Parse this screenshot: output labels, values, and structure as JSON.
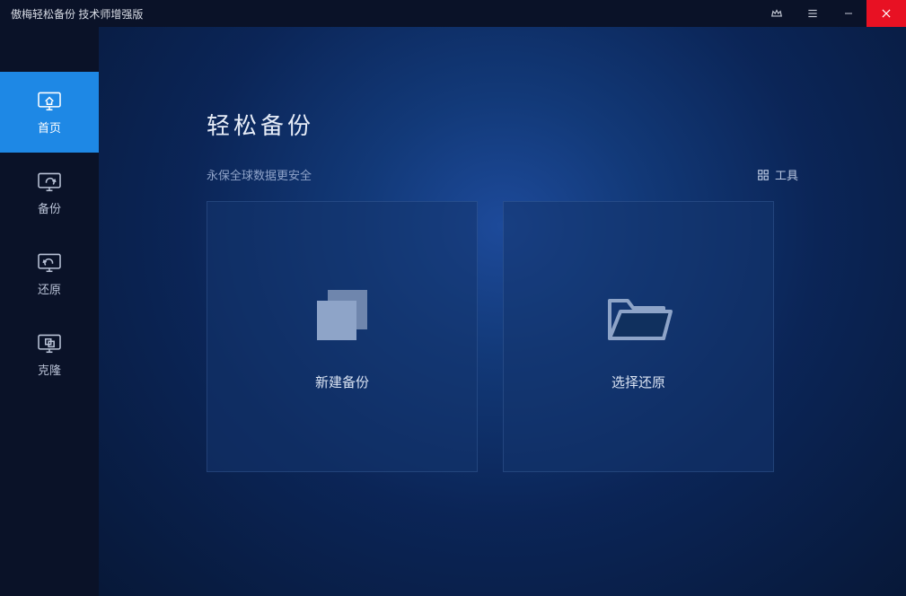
{
  "titlebar": {
    "title": "傲梅轻松备份 技术师增强版"
  },
  "sidebar": {
    "items": [
      {
        "label": "首页"
      },
      {
        "label": "备份"
      },
      {
        "label": "还原"
      },
      {
        "label": "克隆"
      }
    ]
  },
  "main": {
    "title": "轻松备份",
    "subtitle": "永保全球数据更安全",
    "tools_label": "工具",
    "cards": [
      {
        "label": "新建备份"
      },
      {
        "label": "选择还原"
      }
    ]
  }
}
